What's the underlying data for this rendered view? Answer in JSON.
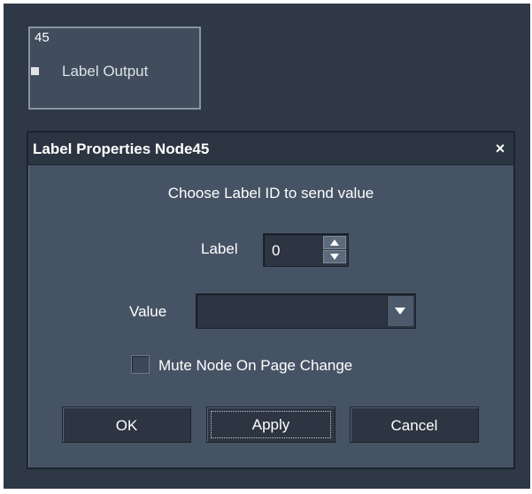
{
  "node": {
    "id": "45",
    "label": "Label Output"
  },
  "dialog": {
    "title": "Label Properties Node45",
    "close_glyph": "×",
    "instruction": "Choose Label ID to send value",
    "label_field": {
      "caption": "Label",
      "value": "0"
    },
    "value_field": {
      "caption": "Value",
      "selected": ""
    },
    "mute_checkbox": {
      "label": "Mute Node On Page Change",
      "checked": false
    },
    "buttons": {
      "ok": "OK",
      "apply": "Apply",
      "cancel": "Cancel"
    }
  },
  "icons": {
    "close": "close-icon",
    "spin_up": "arrow-up-icon",
    "spin_down": "arrow-down-icon",
    "dropdown": "chevron-down-icon"
  },
  "colors": {
    "canvas": "#2e3846",
    "dialog_body": "#465365",
    "title_bar": "#2b3542",
    "control": "#2c3541",
    "text": "#ffffff"
  }
}
